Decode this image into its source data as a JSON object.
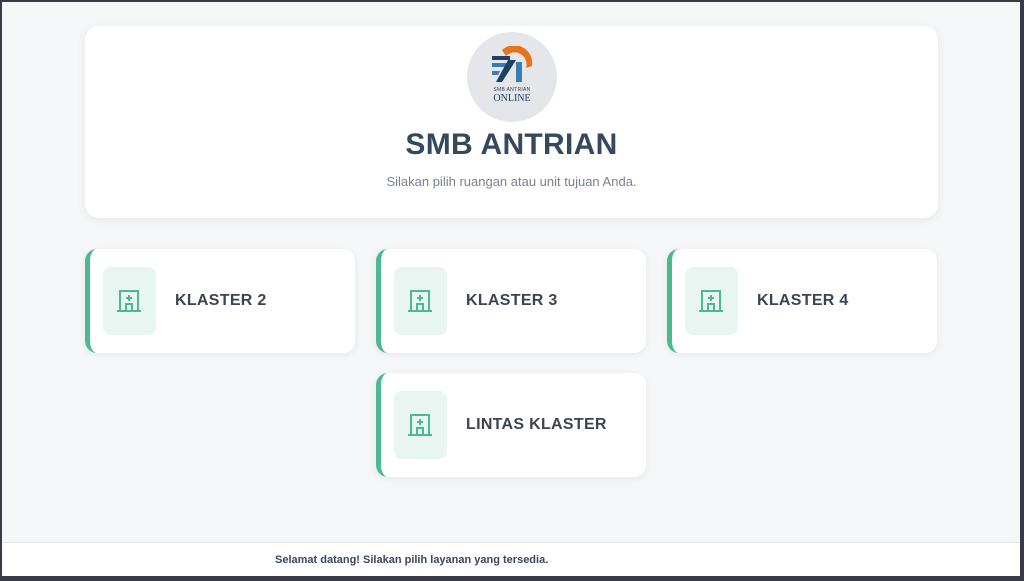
{
  "header": {
    "logo_small_text": "SMB ANTRIAN",
    "logo_big_text": "ONLINE",
    "title": "SMB ANTRIAN",
    "subtitle": "Silakan pilih ruangan atau unit tujuan Anda."
  },
  "rooms": [
    {
      "label": "KLASTER 2"
    },
    {
      "label": "KLASTER 3"
    },
    {
      "label": "KLASTER 4"
    },
    {
      "label": "LINTAS KLASTER"
    }
  ],
  "footer": {
    "message": "Selamat datang! Silakan pilih layanan yang tersedia."
  },
  "colors": {
    "accent": "#4cba91",
    "title": "#34495e",
    "logo_orange": "#e8731f",
    "logo_blue": "#1f3f66"
  },
  "icons": {
    "room": "hospital-icon"
  }
}
